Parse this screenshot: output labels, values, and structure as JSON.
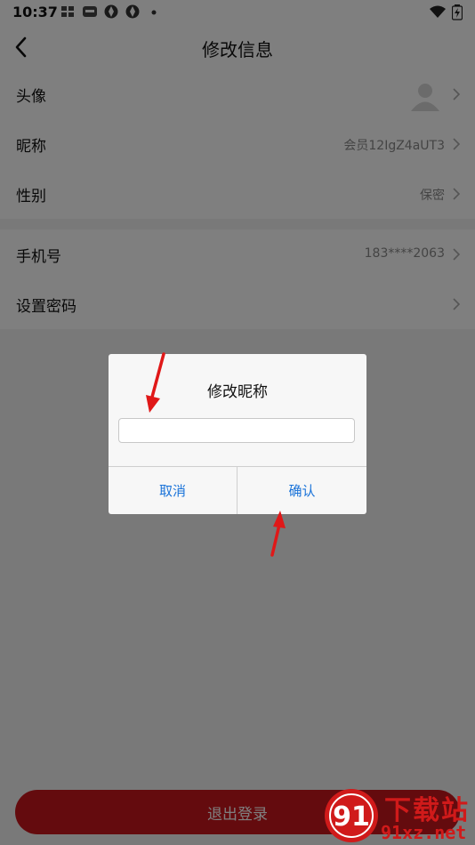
{
  "status_bar": {
    "time": "10:37",
    "icons": [
      "notification-app-icon",
      "news-app-icon",
      "browser-icon",
      "browser-icon",
      "dot-icon",
      "wifi-icon",
      "battery-charging-icon"
    ]
  },
  "header": {
    "title": "修改信息",
    "back_icon": "chevron-left-icon"
  },
  "profile": {
    "avatar": {
      "label": "头像",
      "icon": "user-silhouette-icon"
    },
    "nickname": {
      "label": "昵称",
      "value": "会员12IgZ4aUT3"
    },
    "gender": {
      "label": "性别",
      "value": "保密"
    },
    "phone": {
      "label": "手机号",
      "value": "183****2063"
    },
    "password": {
      "label": "设置密码"
    }
  },
  "logout": {
    "label": "退出登录"
  },
  "dialog": {
    "title": "修改昵称",
    "input_value": "",
    "cancel_label": "取消",
    "confirm_label": "确认"
  },
  "watermark": {
    "logo_text": "91",
    "text_cn": "下载站",
    "text_url": "91xz.net"
  },
  "colors": {
    "accent_red": "#c8161d",
    "dialog_button_blue": "#1a73d9",
    "annotation_arrow_red": "#e01818"
  }
}
